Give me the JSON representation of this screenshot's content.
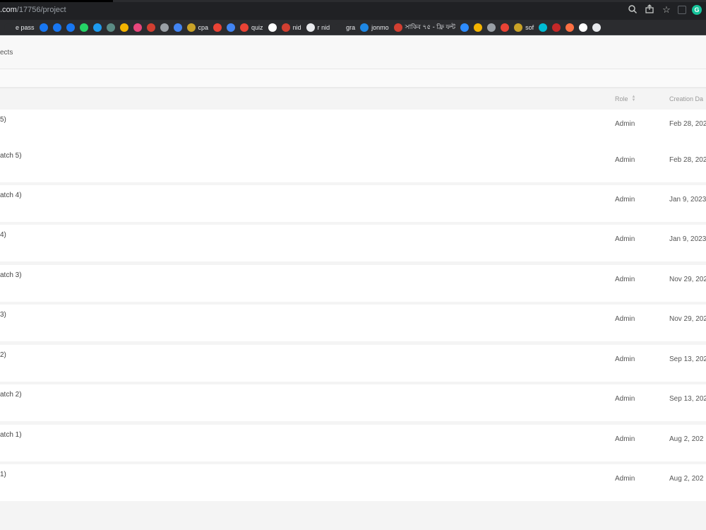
{
  "browser": {
    "url_host": ".com",
    "url_path": "/17756/project",
    "icons": [
      "zoom-icon",
      "share-icon",
      "star-icon",
      "extension-icon",
      "grammarly-icon"
    ]
  },
  "bookmarks": [
    {
      "label": "e pass",
      "icon": "bookmark-favicon",
      "color": "#2b2c2f"
    },
    {
      "label": "",
      "icon": "facebook-icon",
      "color": "#1877f2"
    },
    {
      "label": "",
      "icon": "facebook-icon",
      "color": "#1877f2"
    },
    {
      "label": "",
      "icon": "facebook-icon",
      "color": "#1877f2"
    },
    {
      "label": "",
      "icon": "whatsapp-icon",
      "color": "#25d366"
    },
    {
      "label": "",
      "icon": "twitter-icon",
      "color": "#1d9bf0"
    },
    {
      "label": "",
      "icon": "bookmark-favicon",
      "color": "#5b8c85"
    },
    {
      "label": "",
      "icon": "bookmark-favicon",
      "color": "#f4b400"
    },
    {
      "label": "",
      "icon": "bookmark-favicon",
      "color": "#e8467c"
    },
    {
      "label": "",
      "icon": "bookmark-favicon",
      "color": "#d23f31"
    },
    {
      "label": "",
      "icon": "bookmark-favicon",
      "color": "#9aa0a6"
    },
    {
      "label": "",
      "icon": "translate-icon",
      "color": "#4285f4"
    },
    {
      "label": "cpa",
      "icon": "star-bookmark-icon",
      "color": "#c9a227"
    },
    {
      "label": "",
      "icon": "chrome-icon",
      "color": "#ea4335"
    },
    {
      "label": "",
      "icon": "docs-icon",
      "color": "#4285f4"
    },
    {
      "label": "quiz",
      "icon": "bookmark-favicon",
      "color": "#ea4335"
    },
    {
      "label": "",
      "icon": "google-icon",
      "color": "#ffffff"
    },
    {
      "label": "nid",
      "icon": "bookmark-favicon",
      "color": "#d23f31"
    },
    {
      "label": "r nid",
      "icon": "globe-icon",
      "color": "#e8eaed"
    },
    {
      "label": "gra",
      "icon": "bookmark-favicon",
      "color": "#2b2c2f"
    },
    {
      "label": "jonmo",
      "icon": "bookmark-favicon",
      "color": "#1e88e5"
    },
    {
      "label": "সাকিব ৭৫ - ফ্রি ফন্ট",
      "icon": "bookmark-favicon",
      "color": "#d23f31"
    },
    {
      "label": "",
      "icon": "zoom-app-icon",
      "color": "#2d8cff"
    },
    {
      "label": "",
      "icon": "bookmark-favicon",
      "color": "#f4b400"
    },
    {
      "label": "",
      "icon": "bookmark-favicon",
      "color": "#9aa0a6"
    },
    {
      "label": "",
      "icon": "gmail-icon",
      "color": "#ea4335"
    },
    {
      "label": "sof",
      "icon": "bookmark-favicon",
      "color": "#c9a227"
    },
    {
      "label": "",
      "icon": "bookmark-favicon",
      "color": "#00bcd4"
    },
    {
      "label": "",
      "icon": "bookmark-favicon",
      "color": "#c62828"
    },
    {
      "label": "",
      "icon": "bookmark-favicon",
      "color": "#ff7043"
    },
    {
      "label": "",
      "icon": "bookmark-favicon",
      "color": "#ffffff"
    },
    {
      "label": "",
      "icon": "globe-icon",
      "color": "#e8eaed"
    }
  ],
  "page": {
    "breadcrumb": "ects"
  },
  "table": {
    "columns": {
      "role": "Role",
      "date": "Creation Da"
    },
    "rows": [
      {
        "name": "5)",
        "role": "Admin",
        "date": "Feb 28, 202"
      },
      {
        "name": "atch 5)",
        "role": "Admin",
        "date": "Feb 28, 202"
      },
      {
        "name": "atch 4)",
        "role": "Admin",
        "date": "Jan 9, 2023"
      },
      {
        "name": "4)",
        "role": "Admin",
        "date": "Jan 9, 2023"
      },
      {
        "name": "atch 3)",
        "role": "Admin",
        "date": "Nov 29, 202"
      },
      {
        "name": "3)",
        "role": "Admin",
        "date": "Nov 29, 202"
      },
      {
        "name": "2)",
        "role": "Admin",
        "date": "Sep 13, 202"
      },
      {
        "name": "atch 2)",
        "role": "Admin",
        "date": "Sep 13, 202"
      },
      {
        "name": "atch 1)",
        "role": "Admin",
        "date": "Aug 2, 202"
      },
      {
        "name": "1)",
        "role": "Admin",
        "date": "Aug 2, 202"
      }
    ]
  }
}
